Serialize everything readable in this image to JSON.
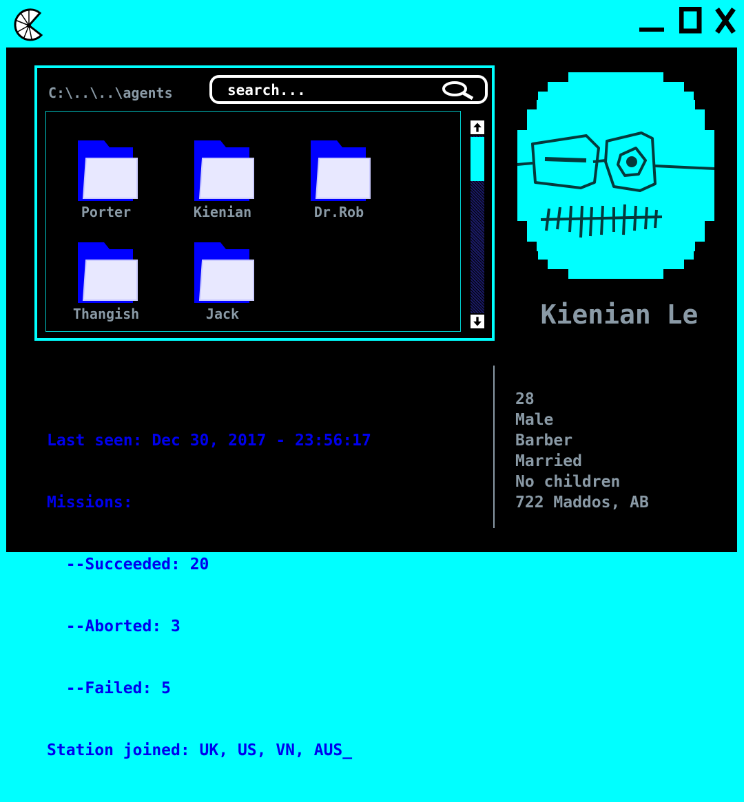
{
  "window": {
    "icons": {
      "app": "pie-logo-icon",
      "minimize": "minimize-icon",
      "maximize": "maximize-icon",
      "close": "close-icon"
    }
  },
  "explorer": {
    "path": "C:\\..\\..\\agents",
    "search": {
      "text": "search...",
      "icon": "magnifier-icon"
    },
    "folders": [
      {
        "name": "Porter"
      },
      {
        "name": "Kienian"
      },
      {
        "name": "Dr.Rob"
      },
      {
        "name": "Thangish"
      },
      {
        "name": "Jack"
      }
    ],
    "scroll_position": 0.25
  },
  "profile": {
    "name": "Kienian Le",
    "avatar_icon": "pixel-face-with-glasses",
    "stats": {
      "last_seen": "Last seen: Dec 30, 2017 - 23:56:17",
      "missions": "Missions:",
      "succeeded": "  --Succeeded: 20",
      "aborted": "  --Aborted: 3",
      "failed": "  --Failed: 5",
      "stations": "Station joined: UK, US, VN, AUS_"
    },
    "details": {
      "age": "28",
      "gender": "Male",
      "occupation": "Barber",
      "marital": "Married",
      "children": "No children",
      "address": "722 Maddos, AB"
    }
  },
  "colors": {
    "accent": "#00ffff",
    "stats_text": "#0000ee",
    "muted_text": "#8a9aa6",
    "folder_blue": "#0000ff"
  }
}
